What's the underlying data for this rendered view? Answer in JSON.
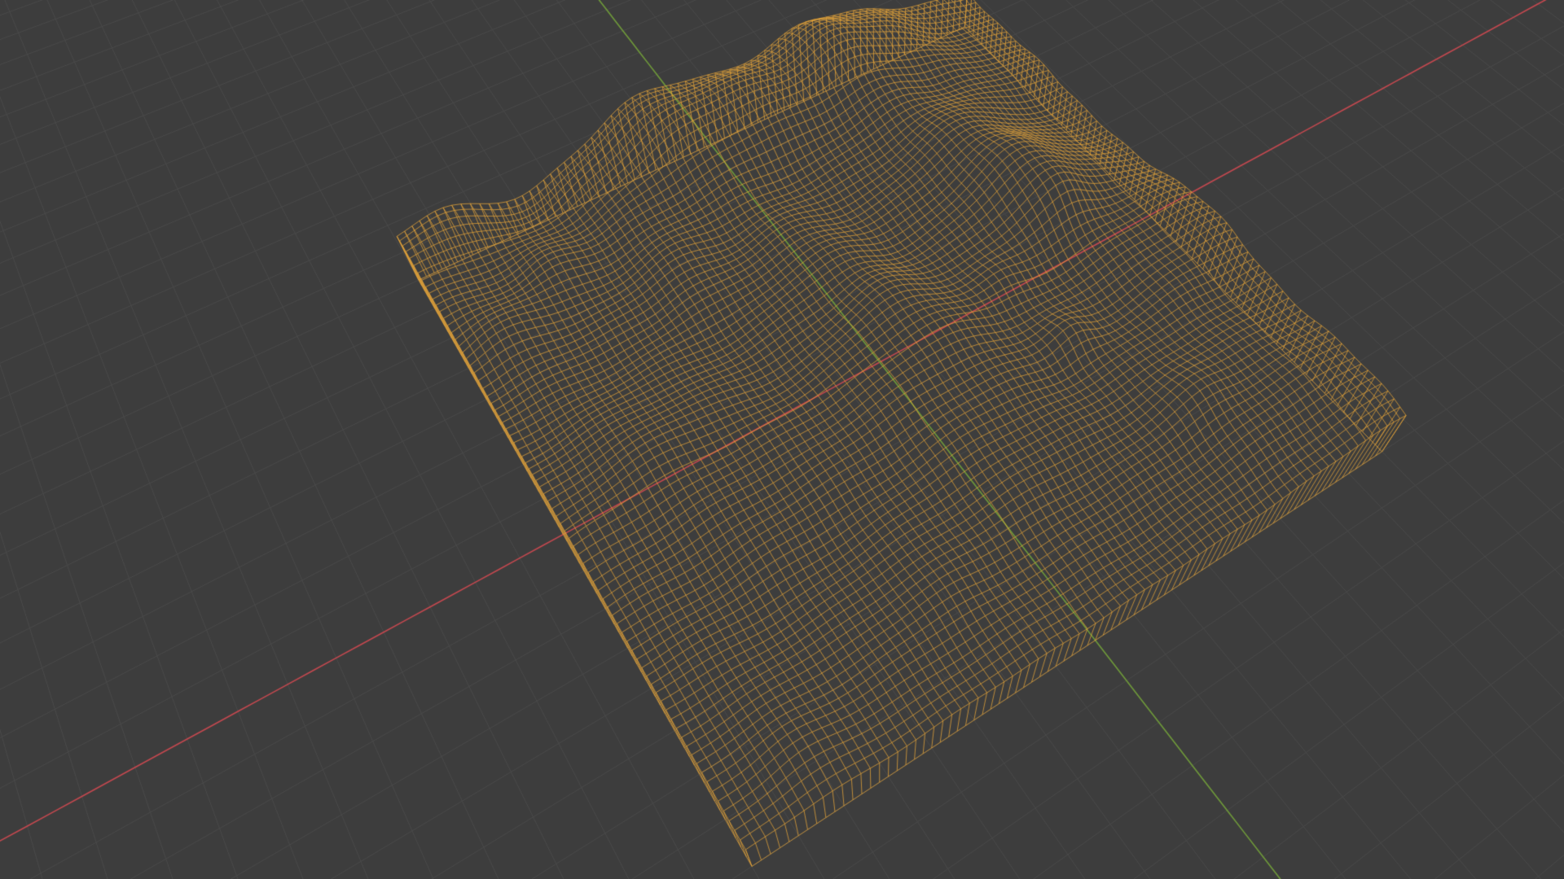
{
  "scene": {
    "background_color": "#3d3d3d",
    "grid_color": "#4a4a4a",
    "x_axis_color": "#c4484f",
    "y_axis_color": "#6f9a3a",
    "wireframe_color": "#e7a53a",
    "terrain_object": "selected-terrain-mesh",
    "display_mode": "wireframe"
  }
}
